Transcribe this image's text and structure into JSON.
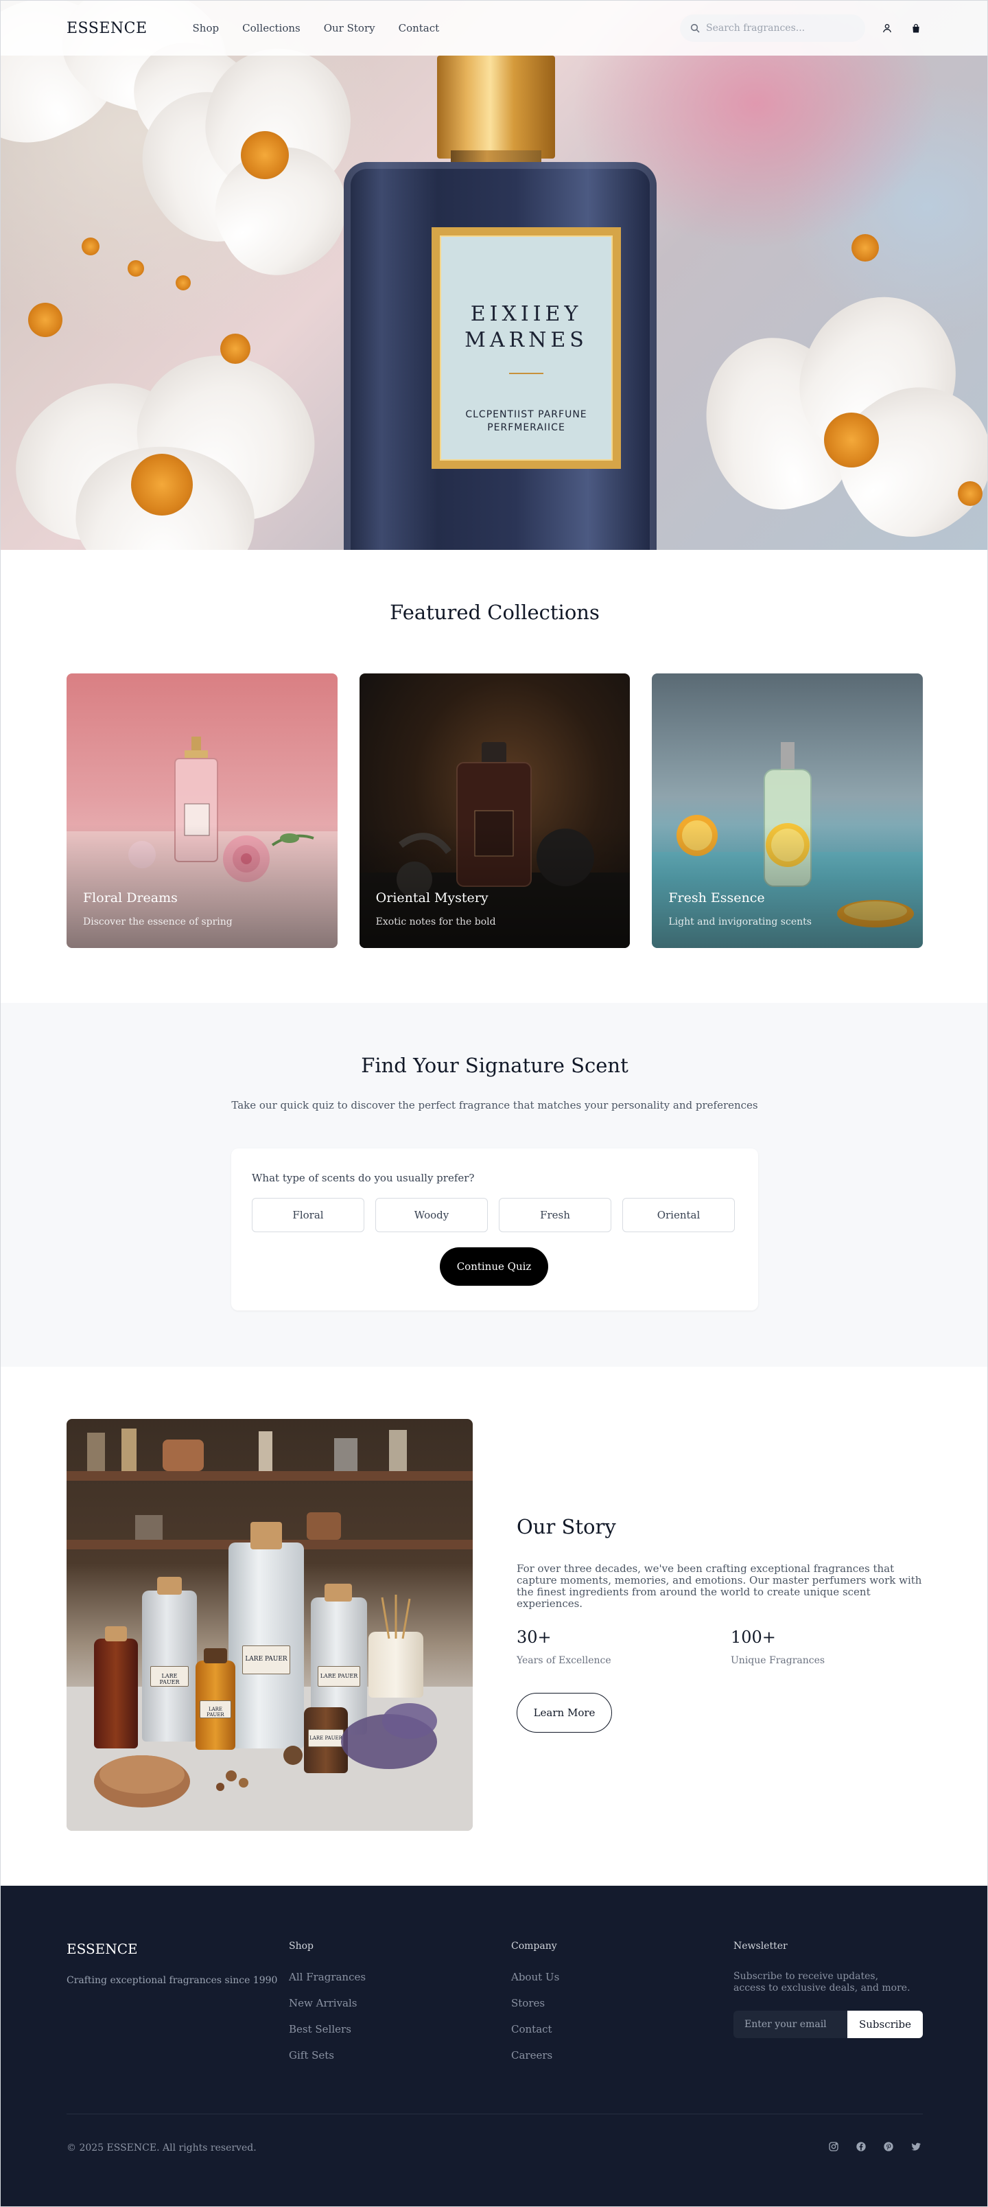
{
  "nav": {
    "brand": "ESSENCE",
    "links": [
      "Shop",
      "Collections",
      "Our Story",
      "Contact"
    ],
    "search_placeholder": "Search fragrances...",
    "icons": [
      "search-icon",
      "user-icon",
      "bag-icon"
    ]
  },
  "hero": {
    "label_line1": "EIXIIEY",
    "label_line2": "MARNES",
    "label_line3": "CLCPENTIIST PARFUNE",
    "label_line4": "PERFMERAIICE"
  },
  "featured": {
    "title": "Featured Collections",
    "cards": [
      {
        "title": "Floral Dreams",
        "subtitle": "Discover the essence of spring"
      },
      {
        "title": "Oriental Mystery",
        "subtitle": "Exotic notes for the bold"
      },
      {
        "title": "Fresh Essence",
        "subtitle": "Light and invigorating scents"
      }
    ]
  },
  "quiz": {
    "title": "Find Your Signature Scent",
    "subtitle": "Take our quick quiz to discover the perfect fragrance that matches your personality and preferences",
    "question": "What type of scents do you usually prefer?",
    "options": [
      "Floral",
      "Woody",
      "Fresh",
      "Oriental"
    ],
    "button": "Continue Quiz"
  },
  "story": {
    "title": "Our Story",
    "text": "For over three decades, we've been crafting exceptional fragrances that capture moments, memories, and emotions. Our master perfumers work with the finest ingredients from around the world to create unique scent experiences.",
    "stats": [
      {
        "value": "30+",
        "label": "Years of Excellence"
      },
      {
        "value": "100+",
        "label": "Unique Fragrances"
      }
    ],
    "button": "Learn More",
    "jar_labels": [
      "LARE PAUER",
      "LARE PAUER",
      "LARE PAUER",
      "LARE PAUER",
      "LARE PAUER"
    ]
  },
  "footer": {
    "brand": "ESSENCE",
    "tagline": "Crafting exceptional fragrances since 1990",
    "shop_head": "Shop",
    "shop_links": [
      "All Fragrances",
      "New Arrivals",
      "Best Sellers",
      "Gift Sets"
    ],
    "company_head": "Company",
    "company_links": [
      "About Us",
      "Stores",
      "Contact",
      "Careers"
    ],
    "news_head": "Newsletter",
    "news_text": "Subscribe to receive updates, access to exclusive deals, and more.",
    "email_placeholder": "Enter your email",
    "subscribe": "Subscribe",
    "copyright": "© 2025 ESSENCE. All rights reserved.",
    "social": [
      "instagram-icon",
      "facebook-icon",
      "pinterest-icon",
      "twitter-icon"
    ]
  },
  "colors": {
    "accent": "#000000",
    "footer_bg": "#141b2d",
    "quiz_bg": "#f7f8fa",
    "bottle_gold": "#d6a548"
  }
}
